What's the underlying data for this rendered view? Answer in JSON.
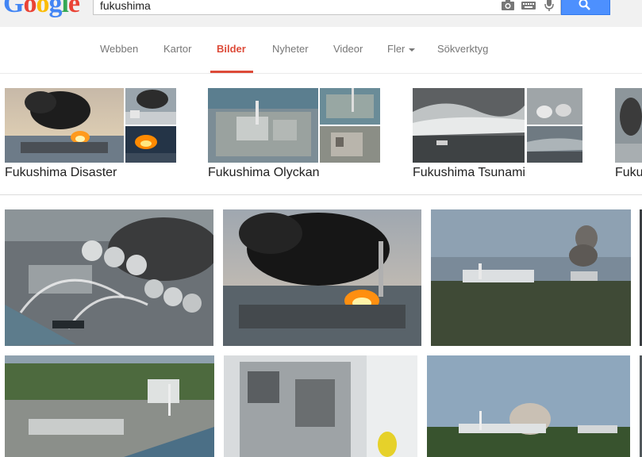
{
  "search": {
    "query": "fukushima",
    "logo": "Google"
  },
  "nav": {
    "tabs": [
      "Webben",
      "Kartor",
      "Bilder",
      "Nyheter",
      "Videor",
      "Fler",
      "Sökverktyg"
    ],
    "active": "Bilder"
  },
  "related": [
    {
      "label": "Fukushima Disaster"
    },
    {
      "label": "Fukushima Olyckan"
    },
    {
      "label": "Fukushima Tsunami"
    },
    {
      "label": "Fuku"
    }
  ],
  "colors": {
    "accent": "#dd4b39",
    "search_button": "#4d90fe",
    "topbar": "#f1f1f1"
  },
  "icons": [
    "camera-icon",
    "keyboard-icon",
    "microphone-icon",
    "search-icon"
  ]
}
